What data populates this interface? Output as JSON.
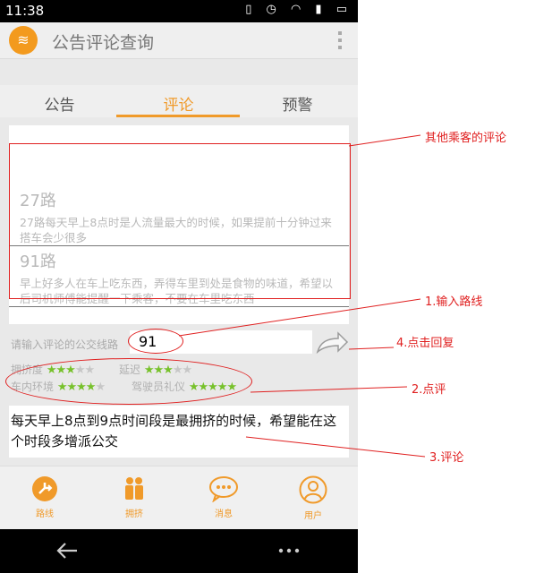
{
  "status": {
    "time": "11:38"
  },
  "app": {
    "title": "公告评论查询"
  },
  "tabs": [
    {
      "label": "公告"
    },
    {
      "label": "评论"
    },
    {
      "label": "预警"
    }
  ],
  "comments": [
    {
      "route": "27路",
      "text": "27路每天早上8点时是人流量最大的时候，如果提前十分钟过来搭车会少很多"
    },
    {
      "route": "91路",
      "text": "早上好多人在车上吃东西，弄得车里到处是食物的味道，希望以后司机师傅能提醒一下乘客，不要在车里吃东西"
    }
  ],
  "form": {
    "route_label": "请输入评论的公交线路",
    "route_value": "91",
    "ratings": [
      {
        "label": "拥挤度",
        "stars": 3
      },
      {
        "label": "延迟",
        "stars": 3
      },
      {
        "label": "车内环境",
        "stars": 4
      },
      {
        "label": "驾驶员礼仪",
        "stars": 5
      }
    ],
    "comment_text": "每天早上8点到9点时间段是最拥挤的时候，希望能在这个时段多增派公交"
  },
  "nav": [
    {
      "label": "路线",
      "icon": "route-icon"
    },
    {
      "label": "拥挤",
      "icon": "crowd-icon"
    },
    {
      "label": "消息",
      "icon": "message-icon"
    },
    {
      "label": "用户",
      "icon": "user-icon"
    }
  ],
  "annotations": {
    "other_comments": "其他乘客的评论",
    "step1": "1.输入路线",
    "step2": "2.点评",
    "step3": "3.评论",
    "step4": "4.点击回复"
  },
  "colors": {
    "accent": "#f09a2a",
    "star": "#77c12b",
    "annotation": "#e02020"
  }
}
